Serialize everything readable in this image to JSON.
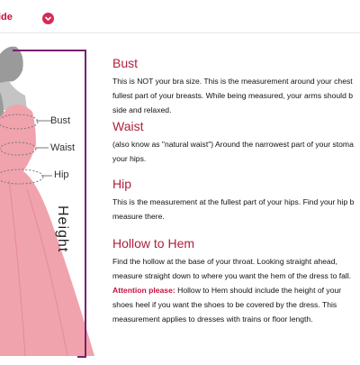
{
  "header": {
    "tab_label": "ide"
  },
  "figure": {
    "height_label": "Height",
    "measures": {
      "bust": "Bust",
      "waist": "Waist",
      "hip": "Hip"
    }
  },
  "sections": {
    "bust": {
      "title": "Bust",
      "line1": "This is NOT your bra size. This is the measurement around your chest",
      "line2": "fullest part of your breasts. While being measured, your arms should b",
      "line3": "side and relaxed."
    },
    "waist": {
      "title": "Waist",
      "line1": "(also know as \"natural waist\") Around the narrowest part of your stoma",
      "line2": "your hips."
    },
    "hip": {
      "title": "Hip",
      "line1": "This is the measurement at the fullest part of your hips. Find your hip b",
      "line2": "measure there."
    },
    "hollow": {
      "title": "Hollow to Hem",
      "line1": "Find the hollow at the base of your throat. Looking straight ahead,",
      "line2": "measure straight down to where you want the hem of the dress to fall.",
      "attention_label": "Attention please:",
      "line3": "Hollow to Hem should include the height of your",
      "line4": "shoes heel if you want the shoes to be covered by the dress. This",
      "line5": "measurement applies to dresses with trains or floor length."
    }
  },
  "colors": {
    "accent": "#c8103c",
    "dress": "#f0a3ad",
    "height_bar": "#7a1f6e"
  }
}
